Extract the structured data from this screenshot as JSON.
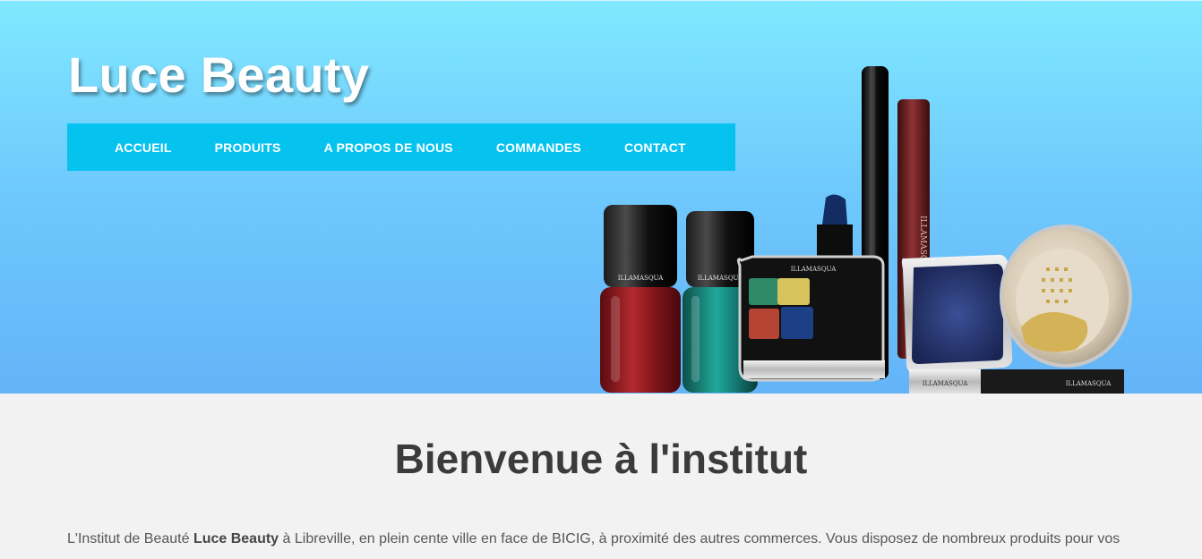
{
  "header": {
    "site_title": "Luce Beauty"
  },
  "nav": {
    "items": [
      {
        "label": "ACCUEIL"
      },
      {
        "label": "PRODUITS"
      },
      {
        "label": "A PROPOS DE NOUS"
      },
      {
        "label": "COMMANDES"
      },
      {
        "label": "CONTACT"
      }
    ]
  },
  "hero_image": {
    "brand_text": "ILLAMASQUA"
  },
  "main": {
    "heading": "Bienvenue à l'institut",
    "intro_part1": "L'Institut de Beauté ",
    "intro_bold": "Luce Beauty",
    "intro_part2": " à Libreville, en plein cente ville en face de BICIG, à proximité des autres commerces. Vous disposez de nombreux produits pour vos"
  },
  "colors": {
    "nav_background": "#06c2ef",
    "header_gradient_top": "#80e8ff",
    "header_gradient_bottom": "#64b4f8",
    "page_background": "#f2f2f2",
    "heading_color": "#3b3b3b"
  }
}
